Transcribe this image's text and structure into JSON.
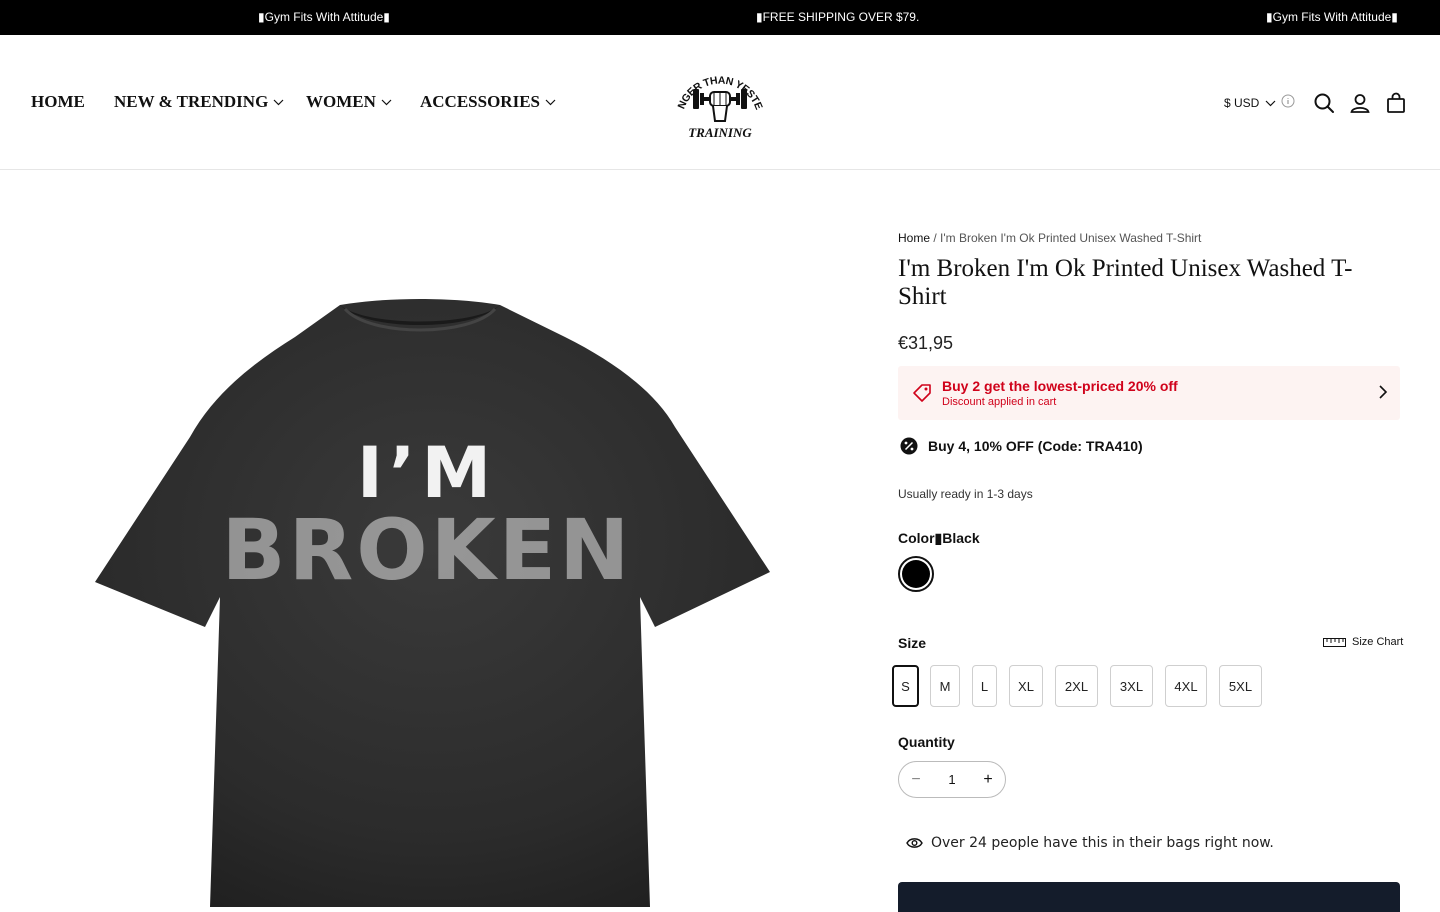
{
  "announcement": {
    "left": "▮Gym Fits With Attitude▮",
    "center": "▮FREE SHIPPING OVER $79.",
    "right": "▮Gym Fits With Attitude▮"
  },
  "nav": {
    "items": [
      {
        "label": "HOME",
        "dropdown": false
      },
      {
        "label": "NEW & TRENDING",
        "dropdown": true
      },
      {
        "label": "WOMEN",
        "dropdown": true
      },
      {
        "label": "ACCESSORIES",
        "dropdown": true
      }
    ]
  },
  "logo": {
    "text_top": "STRONGER THAN YESTERDAY",
    "text_bottom": "TRAINING"
  },
  "header": {
    "currency": "$ USD",
    "icons": [
      "info-icon",
      "search-icon",
      "account-icon",
      "cart-icon"
    ]
  },
  "breadcrumb": {
    "home": "Home",
    "separator": " / ",
    "current": "I'm Broken I'm Ok Printed Unisex Washed T-Shirt"
  },
  "product": {
    "title": "I'm Broken I'm Ok Printed Unisex Washed T-Shirt",
    "price": "€31,95",
    "image_text_line1": "I’M",
    "image_text_line2": "BROKEN",
    "color_label": "Color▮Black",
    "color_value_hex": "#000000",
    "ready_text": "Usually ready in 1-3 days"
  },
  "promo": {
    "title": "Buy 2 get the lowest-priced 20% off",
    "subtitle": "Discount applied in cart",
    "color": "#d0021b"
  },
  "coupon": {
    "text": "Buy 4, 10% OFF (Code: TRA410)"
  },
  "size": {
    "label": "Size",
    "chart_label": "Size Chart",
    "options": [
      "S",
      "M",
      "L",
      "XL",
      "2XL",
      "3XL",
      "4XL",
      "5XL"
    ],
    "selected": "S"
  },
  "quantity": {
    "label": "Quantity",
    "value": "1",
    "minus": "−",
    "plus": "+"
  },
  "social_proof": {
    "text": "Over 24 people have this in their bags right now."
  }
}
